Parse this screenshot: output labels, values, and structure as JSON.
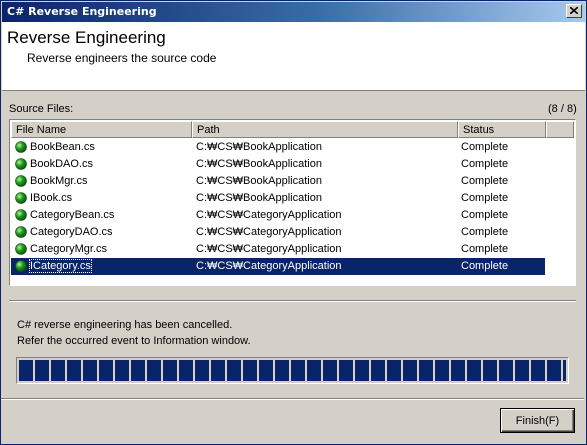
{
  "window": {
    "title": "C# Reverse Engineering"
  },
  "header": {
    "title": "Reverse Engineering",
    "subtitle": "Reverse engineers the source code"
  },
  "source_files": {
    "label": "Source Files:",
    "count": "(8 / 8)",
    "columns": [
      "File Name",
      "Path",
      "Status"
    ],
    "rows": [
      {
        "name": "BookBean.cs",
        "path": "C:₩CS₩BookApplication",
        "status": "Complete"
      },
      {
        "name": "BookDAO.cs",
        "path": "C:₩CS₩BookApplication",
        "status": "Complete"
      },
      {
        "name": "BookMgr.cs",
        "path": "C:₩CS₩BookApplication",
        "status": "Complete"
      },
      {
        "name": "IBook.cs",
        "path": "C:₩CS₩BookApplication",
        "status": "Complete"
      },
      {
        "name": "CategoryBean.cs",
        "path": "C:₩CS₩CategoryApplication",
        "status": "Complete"
      },
      {
        "name": "CategoryDAO.cs",
        "path": "C:₩CS₩CategoryApplication",
        "status": "Complete"
      },
      {
        "name": "CategoryMgr.cs",
        "path": "C:₩CS₩CategoryApplication",
        "status": "Complete"
      },
      {
        "name": "ICategory.cs",
        "path": "C:₩CS₩CategoryApplication",
        "status": "Complete"
      }
    ],
    "selected_index": 7,
    "status_icon": "green-circle-icon"
  },
  "messages": {
    "line1": "C# reverse engineering has been cancelled.",
    "line2": "Refer the occurred event to Information window."
  },
  "progress": {
    "fraction": 1.0
  },
  "buttons": {
    "finish": "Finish(F)"
  },
  "colors": {
    "selection": "#0a246a",
    "progress_block": "#0a246a",
    "status_ok": "#1f9a1f"
  }
}
